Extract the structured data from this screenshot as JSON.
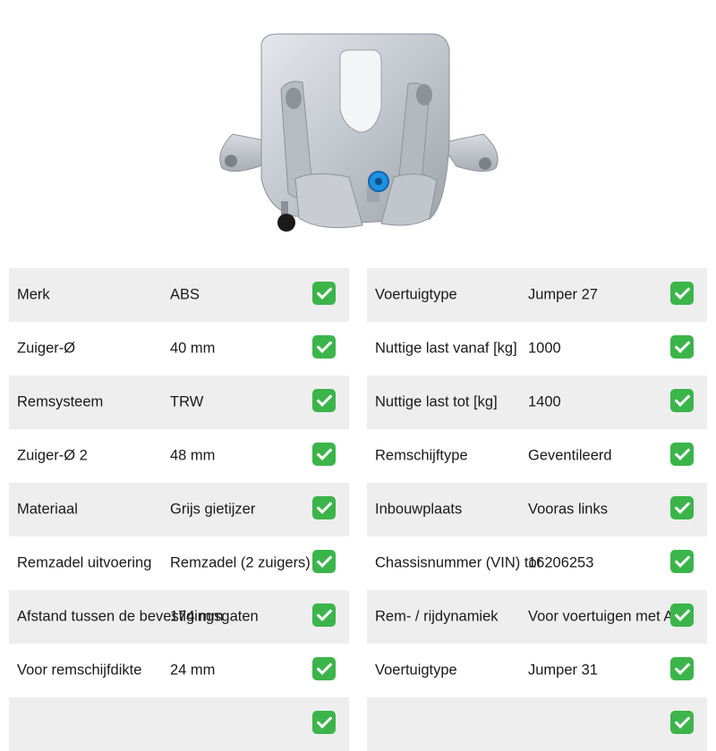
{
  "product": {
    "image_name": "brake-caliper"
  },
  "colors": {
    "check": "#3bb54a",
    "row_shade": "#eeeeee",
    "caliper": "#c8ccd2",
    "bleed_cap": "#1e90e0"
  },
  "left_table": [
    {
      "label": "Merk",
      "value": "ABS"
    },
    {
      "label": "Zuiger-Ø",
      "value": "40 mm"
    },
    {
      "label": "Remsysteem",
      "value": "TRW"
    },
    {
      "label": "Zuiger-Ø 2",
      "value": "48 mm"
    },
    {
      "label": "Materiaal",
      "value": "Grijs gietijzer"
    },
    {
      "label": "Remzadel uitvoering",
      "value": "Remzadel (2 zuigers)"
    },
    {
      "label": "Afstand tussen de bevestigingsgaten",
      "value": "174 mm"
    },
    {
      "label": "Voor remschijfdikte",
      "value": "24 mm"
    }
  ],
  "right_table": [
    {
      "label": "Voertuigtype",
      "value": "Jumper 27"
    },
    {
      "label": "Nuttige last vanaf [kg]",
      "value": "1000"
    },
    {
      "label": "Nuttige last tot [kg]",
      "value": "1400"
    },
    {
      "label": "Remschijftype",
      "value": "Geventileerd"
    },
    {
      "label": "Inbouwplaats",
      "value": "Vooras links"
    },
    {
      "label": "Chassisnummer (VIN) tot",
      "value": "16206253"
    },
    {
      "label": "Rem- / rijdynamiek",
      "value": "Voor voertuigen met ABS"
    },
    {
      "label": "Voertuigtype",
      "value": "Jumper 31"
    }
  ]
}
